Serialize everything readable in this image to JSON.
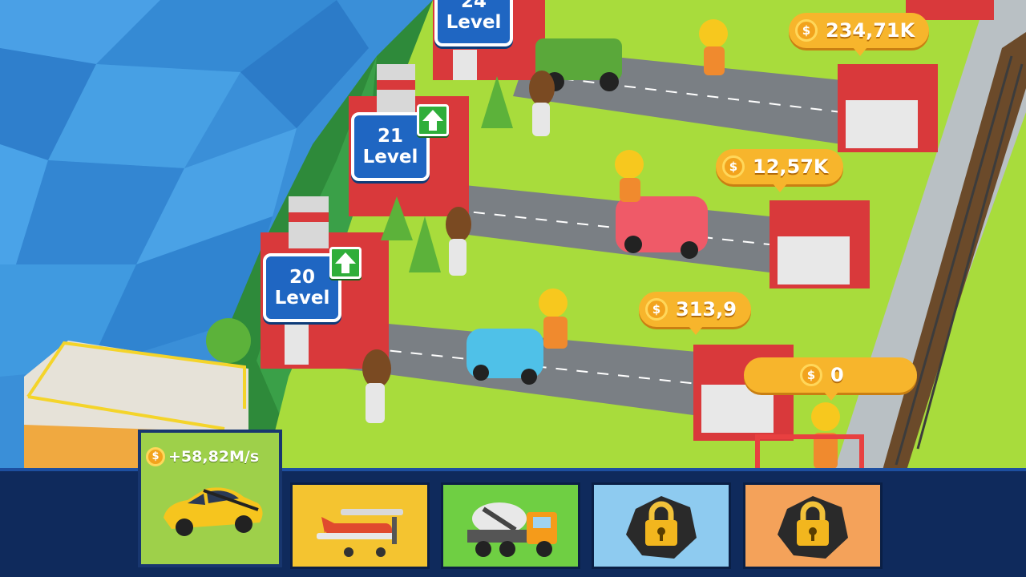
{
  "buildings": [
    {
      "level_number": "24",
      "level_word": "Level"
    },
    {
      "level_number": "21",
      "level_word": "Level"
    },
    {
      "level_number": "20",
      "level_word": "Level"
    }
  ],
  "coin_bubbles": [
    "234,71K",
    "12,57K",
    "313,9",
    "0"
  ],
  "selected_vehicle": {
    "income_rate": "+58,82M/s",
    "icon": "yellow-sports-car"
  },
  "vehicle_slots": [
    {
      "icon": "red-propeller-plane",
      "color": "#f4c430",
      "locked": false
    },
    {
      "icon": "cement-mixer-truck",
      "color": "#6fcf43",
      "locked": false
    },
    {
      "icon": "padlock",
      "color": "#8ecbf0",
      "locked": true
    },
    {
      "icon": "padlock",
      "color": "#f4a25a",
      "locked": true
    }
  ],
  "colors": {
    "coin": "#f7b52c",
    "level_sign": "#1f66c2",
    "upgrade": "#2fae3a",
    "bar": "#0f2a5c",
    "water": "#3a8fd8",
    "grass": "#a8dc3c"
  }
}
